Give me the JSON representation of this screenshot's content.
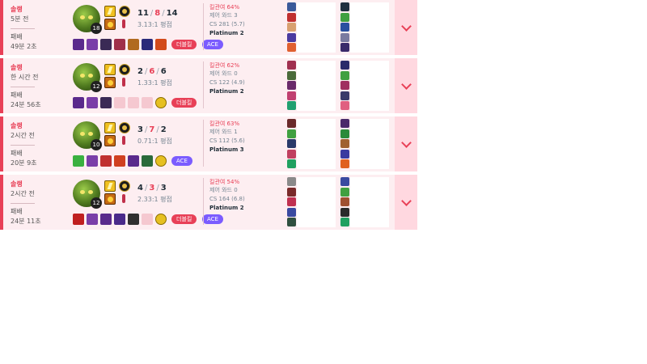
{
  "colors": {
    "loss_accent": "#e84057",
    "ace": "#7b5cff",
    "row_bg": "#fdeef1"
  },
  "matches": [
    {
      "queue": "솔랭",
      "time_ago": "5분 전",
      "result": "패배",
      "duration": "49분 2초",
      "level": "18",
      "kills": "11",
      "deaths": "8",
      "assists": "14",
      "kda_ratio": "3.13:1 평점",
      "kill_participation": "킬관여 64%",
      "control_wards": "제어 와드 3",
      "cs": "CS 281 (5.7)",
      "tier": "Platinum 2",
      "badges": [
        "더블킬",
        "ACE"
      ],
      "items": [
        "#5a2a8c",
        "#7a3ea8",
        "#3a2a55",
        "#a0304a",
        "#b06a20",
        "#2a2a7a",
        "#d24a1a"
      ],
      "team_a": [
        "#3a5a9a",
        "#c03030",
        "#d8a070",
        "#4a3aa0",
        "#e06030"
      ],
      "team_b": [
        "#203040",
        "#40a040",
        "#2a50a0",
        "#7a7aa0",
        "#3a2a6a"
      ]
    },
    {
      "queue": "솔랭",
      "time_ago": "한 시간 전",
      "result": "패배",
      "duration": "24분 56초",
      "level": "12",
      "kills": "2",
      "deaths": "6",
      "assists": "6",
      "kda_ratio": "1.33:1 평점",
      "kill_participation": "킬관여 62%",
      "control_wards": "제어 와드 0",
      "cs": "CS 122 (4.9)",
      "tier": "Platinum 2",
      "badges": [
        "더블킬"
      ],
      "items": [
        "#5a2a8c",
        "#7a3ea8",
        "#3a2a55",
        "",
        "",
        "",
        "ward"
      ],
      "team_a": [
        "#a03050",
        "#4a6a3a",
        "#6a2a6a",
        "#c04070",
        "#20a070"
      ],
      "team_b": [
        "#2a2a6a",
        "#40a040",
        "#a03060",
        "#3a3a6a",
        "#e06080"
      ]
    },
    {
      "queue": "솔랭",
      "time_ago": "2시간 전",
      "result": "패배",
      "duration": "20분 9초",
      "level": "10",
      "kills": "3",
      "deaths": "7",
      "assists": "2",
      "kda_ratio": "0.71:1 평점",
      "kill_participation": "킬관여 63%",
      "control_wards": "제어 와드 1",
      "cs": "CS 112 (5.6)",
      "tier": "Platinum 3",
      "badges": [
        "ACE"
      ],
      "items": [
        "#3ab040",
        "#7a3ea8",
        "#c03030",
        "#d04020",
        "#5a2a8c",
        "#2a6a3a",
        "ward"
      ],
      "team_a": [
        "#6a2a2a",
        "#40a040",
        "#2a3a6a",
        "#c04060",
        "#20a060"
      ],
      "team_b": [
        "#4a2a6a",
        "#2a8a3a",
        "#a06030",
        "#3a3aa0",
        "#e06020"
      ]
    },
    {
      "queue": "솔랭",
      "time_ago": "2시간 전",
      "result": "패배",
      "duration": "24분 11초",
      "level": "12",
      "kills": "4",
      "deaths": "3",
      "assists": "3",
      "kda_ratio": "2.33:1 평점",
      "kill_participation": "킬관여 54%",
      "control_wards": "제어 와드 0",
      "cs": "CS 164 (6.8)",
      "tier": "Platinum 2",
      "badges": [
        "더블킬",
        "ACE"
      ],
      "items": [
        "#c02020",
        "#7a3ea8",
        "#5a2a8c",
        "#4a2a8a",
        "#303030",
        "",
        "ward"
      ],
      "team_a": [
        "#8a8a8a",
        "#7a2a2a",
        "#c03050",
        "#3a4aa0",
        "#305040"
      ],
      "team_b": [
        "#3a4aa0",
        "#40a040",
        "#a05030",
        "#2a2a2a",
        "#20a060"
      ]
    }
  ]
}
